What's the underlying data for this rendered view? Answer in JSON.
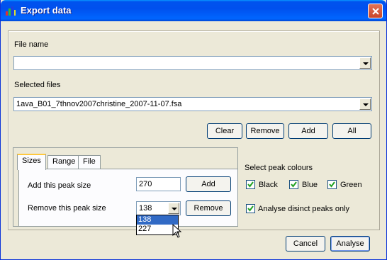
{
  "window": {
    "title": "Export data"
  },
  "file_name": {
    "label": "File name",
    "value": ""
  },
  "selected_files": {
    "label": "Selected files",
    "value": "1ava_B01_7thnov2007christine_2007-11-07.fsa"
  },
  "file_buttons": {
    "clear": "Clear",
    "remove": "Remove",
    "add": "Add",
    "all": "All"
  },
  "tabs": [
    {
      "label": "Sizes"
    },
    {
      "label": "Range"
    },
    {
      "label": "File"
    }
  ],
  "sizes": {
    "add_label": "Add this peak size",
    "add_value": "270",
    "add_button": "Add",
    "remove_label": "Remove this peak size",
    "remove_value": "138",
    "remove_button": "Remove",
    "remove_options": [
      "138",
      "227"
    ]
  },
  "peak_colours": {
    "label": "Select peak colours",
    "black": "Black",
    "blue": "Blue",
    "green": "Green",
    "analyse_distinct": "Analyse disinct peaks only"
  },
  "footer": {
    "cancel": "Cancel",
    "analyse": "Analyse"
  },
  "colors": {
    "title_bar": "#0054e3",
    "selection": "#316ac5",
    "background": "#ece9d8"
  }
}
